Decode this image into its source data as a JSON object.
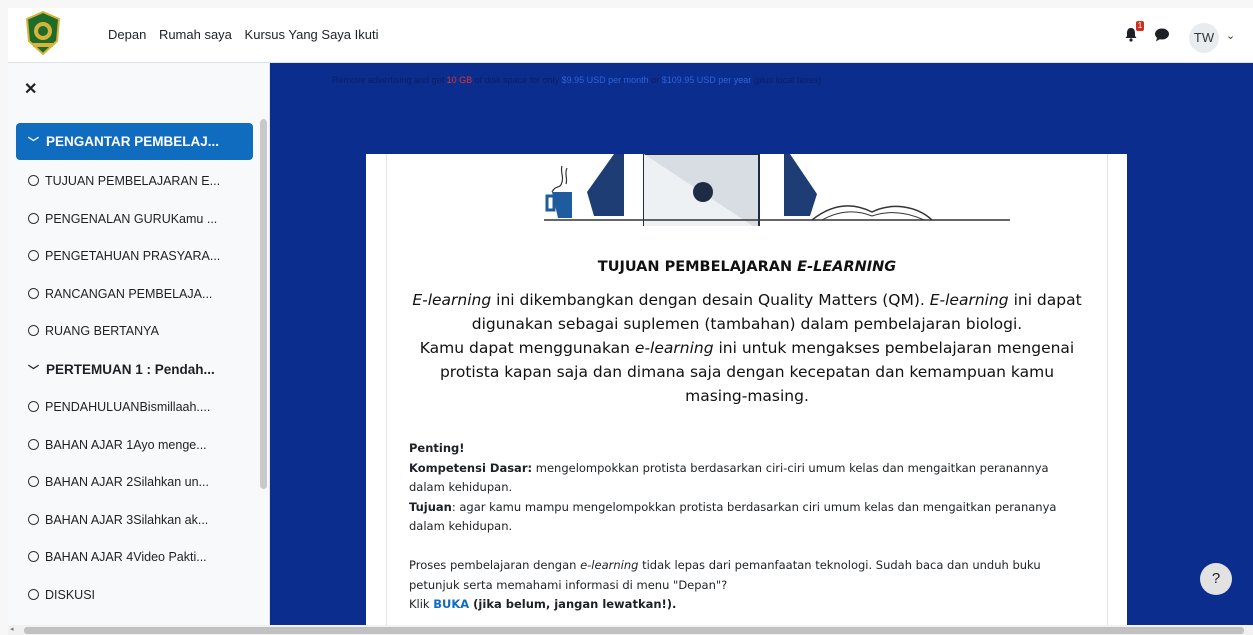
{
  "navbar": {
    "links": [
      "Depan",
      "Rumah saya",
      "Kursus Yang Saya Ikuti"
    ],
    "notification_count": "1",
    "user_initials": "TW"
  },
  "drawer": {
    "sections": [
      {
        "title": "PENGANTAR PEMBELAJ...",
        "active": true,
        "items": [
          "TUJUAN PEMBELAJARAN E...",
          "PENGENALAN GURUKamu ...",
          "PENGETAHUAN PRASYARA...",
          "RANCANGAN PEMBELAJA...",
          "RUANG BERTANYA"
        ]
      },
      {
        "title": "PERTEMUAN 1 : Pendah...",
        "active": false,
        "items": [
          "PENDAHULUANBismillaah....",
          "BAHAN AJAR 1Ayo menge...",
          "BAHAN AJAR 2Silahkan un...",
          "BAHAN AJAR 3Silahkan ak...",
          "BAHAN AJAR 4Video Pakti...",
          "DISKUSI"
        ]
      }
    ]
  },
  "ad": {
    "p1": "Remove advertising and get ",
    "p2": "10 GB",
    "p3": " of disk space for only ",
    "p4": "$9.95 USD per month",
    "p5": " or ",
    "p6": "$109.95 USD per year",
    "p7": " (plus local taxes)"
  },
  "content": {
    "title_main": "TUJUAN PEMBELAJARAN ",
    "title_em": "E-LEARNING",
    "para": {
      "a": "E-learning",
      "b": " ini dikembangkan dengan desain  Quality Matters (QM). ",
      "c": "E-learning",
      "d": " ini dapat digunakan sebagai suplemen (tambahan) dalam pembelajaran biologi.",
      "e": "Kamu dapat menggunakan ",
      "f": "e-learning",
      "g": " ini  untuk mengakses pembelajaran mengenai protista kapan saja dan dimana saja dengan kecepatan dan kemampuan kamu masing-masing."
    },
    "penting": "Penting!",
    "kd_label": "Kompetensi",
    "kd_label2": " Dasar:",
    "kd_text": " mengelompokkan protista berdasarkan ciri-ciri umum kelas dan mengaitkan peranannya dalam kehidupan.",
    "tujuan_label": "Tujuan",
    "tujuan_text": ": agar kamu mampu mengelompokkan protista berdasarkan ciri umum kelas dan mengaitkan perananya dalam kehidupan.",
    "proses_a": "Proses pembelajaran dengan ",
    "proses_b": "e-learning",
    "proses_c": "  tidak lepas dari pemanfaatan teknologi. Sudah baca dan unduh buku petunjuk serta memahami  informasi di menu \"Depan\"?",
    "klik": "Klik ",
    "buka": "BUKA",
    "klik_rest": " (jika belum, jangan lewatkan!)."
  },
  "help_label": "?"
}
